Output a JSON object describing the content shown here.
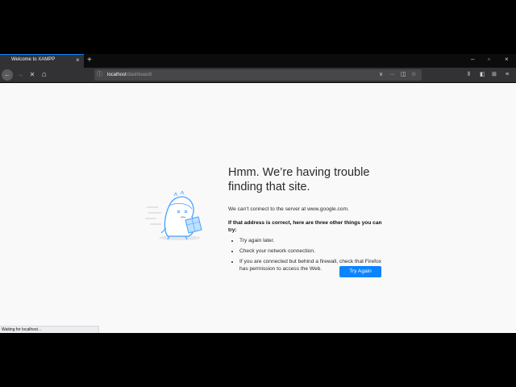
{
  "tab": {
    "title": "Welcome to XAMPP",
    "close": "×",
    "new_tab": "+"
  },
  "window_controls": {
    "minimize": "–",
    "maximize": "▫",
    "close": "×"
  },
  "nav": {
    "back": "←",
    "forward": "→",
    "stop": "✕",
    "home": "⌂"
  },
  "urlbar": {
    "host": "localhost",
    "path": "/dashboard/",
    "info": "ⓘ"
  },
  "url_actions": {
    "dropdown": "∨",
    "more": "···",
    "pocket": "◫",
    "bookmark": "☆"
  },
  "toolbar": {
    "library": "⫴",
    "sidebar": "◧",
    "extensions": "⊞",
    "menu": "≡"
  },
  "error": {
    "title": "Hmm. We’re having trouble finding that site.",
    "message": "We can’t connect to the server at www.google.com.",
    "subtitle": "If that address is correct, here are three other things you can try:",
    "suggestions": [
      "Try again later.",
      "Check your network connection.",
      "If you are connected but behind a firewall, check that Firefox has permission to access the Web."
    ],
    "button": "Try Again"
  },
  "status": {
    "text": "Waiting for localhost…"
  },
  "colors": {
    "accent": "#0a84ff",
    "chrome_dark": "#323234",
    "tabstrip": "#0c0c0d",
    "page_bg": "#f9f9fa",
    "illustration": "#45a1ff"
  }
}
